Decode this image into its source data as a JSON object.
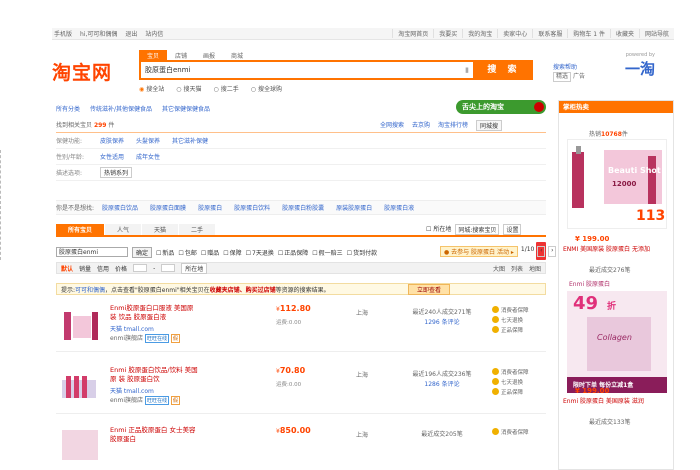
{
  "topbar": {
    "left": [
      "手机版",
      "hi,可可和偶偶",
      "退出",
      "站内信"
    ],
    "right": [
      "淘宝网首页",
      "我要买",
      "我的淘宝",
      "卖家中心",
      "联系客服",
      "购物车 1 件",
      "收藏夹",
      "网站导航"
    ]
  },
  "logo": "淘宝网",
  "search": {
    "tabs": [
      "宝贝",
      "店铺",
      "画报",
      "商城"
    ],
    "value": "胶原蛋白enmi",
    "button": "搜 索",
    "radios": [
      "搜全站",
      "搜天猫",
      "搜二手",
      "搜全球购"
    ],
    "help_line1": "搜索帮助",
    "help_ad": "精选",
    "help_line2": "广告",
    "yitao": "一淘",
    "yitao_small": "powered by"
  },
  "crumbs": [
    "所有分类",
    "传统滋补/其他保健食品",
    "其它保健保健食品"
  ],
  "banner": "舌尖上的淘宝",
  "result": {
    "found_prefix": "找到相关宝贝",
    "found_count": "299",
    "found_suffix": "件",
    "tools": [
      "全网搜索",
      "去京购",
      "淘宝排行榜"
    ],
    "tools_box": "同城搜"
  },
  "filters": [
    {
      "label": "保健功能:",
      "values": [
        "皮肤保养",
        "头髮保养",
        "其它滋补保健"
      ]
    },
    {
      "label": "性别/年龄:",
      "values": [
        "女性适用",
        "成年女性"
      ]
    },
    {
      "label": "描述选项:",
      "select": "热销系列"
    }
  ],
  "related": {
    "label": "你是不是想找:",
    "items": [
      "胶原蛋白饮品",
      "胶原蛋白面膜",
      "胶原蛋白",
      "胶原蛋白饮料",
      "胶原蛋白粉胶囊",
      "原装胶原蛋白",
      "胶原蛋白液"
    ]
  },
  "result_tabs": [
    "所有宝贝",
    "人气",
    "天猫",
    "二手"
  ],
  "mini": {
    "check": "所在地",
    "box1": "同城:搜索宝贝",
    "box2": "设置"
  },
  "filter_row": {
    "input": "胶原蛋白enmi",
    "confirm": "确定",
    "checks": [
      "新品",
      "包邮",
      "赠品",
      "保障",
      "7天退换",
      "正品保障",
      "假一赔三",
      "货到付款"
    ]
  },
  "pager": {
    "tip": "● 去参与 胶原蛋白 活动 ▸",
    "pages": "1/10"
  },
  "sortbar": {
    "items": [
      "默认",
      "销量",
      "信用",
      "价格"
    ],
    "sep": "-",
    "select": "所在地",
    "right": [
      "大图",
      "列表",
      "地图"
    ]
  },
  "notice": {
    "prefix": "提示:",
    "link": "可可和偶偶",
    "text": "，点击查看\"胶原蛋白enmi\"相关宝贝在",
    "bold": "收藏夹店铺、购买过店铺",
    "tail": "等资源的搜索结果。",
    "button": "立即查看"
  },
  "items": [
    {
      "title": "Enmi胶原蛋白口服液 美国原",
      "title_hl": "装 饮品 胶原蛋白液",
      "shop": "天猫 tmall.com",
      "shop2": "enmi旗舰店",
      "badge": "旺旺在线",
      "badge2": "假",
      "price": "112.80",
      "price_prefix": "¥",
      "pnote": "运费:0.00",
      "loc": "上海",
      "sales": "最近240人成交271笔",
      "reviews": "1296 条评论",
      "svc": [
        "消费者保障",
        "七天退换",
        "正品保障"
      ]
    },
    {
      "title": "Enmi 胶原蛋白饮品/饮料 美国原",
      "title_hl": "装 胶原蛋白饮",
      "shop": "天猫 tmall.com",
      "shop2": "enmi旗舰店",
      "badge": "旺旺在线",
      "badge2": "假",
      "price": "70.80",
      "price_prefix": "¥",
      "pnote": "运费:0.00",
      "loc": "上海",
      "sales": "最近196人成交236笔",
      "reviews": "1286 条评论",
      "svc": [
        "消费者保障",
        "七天退换",
        "正品保障"
      ]
    },
    {
      "title": "Enmi 正品胶原蛋白 女士美容",
      "title_hl": "胶原蛋白",
      "shop": "",
      "shop2": "",
      "badge": "",
      "badge2": "",
      "price": "850.00",
      "price_prefix": "¥",
      "pnote": "",
      "loc": "上海",
      "sales": "最近成交205笔",
      "reviews": "",
      "svc": [
        "消费者保障"
      ]
    }
  ],
  "side": {
    "header": "掌柜热卖",
    "count_prefix": "热销",
    "count": "10768",
    "count_suffix": "件",
    "p1_brand": "Beauti Shot",
    "p1_num": "12000",
    "p1_price": "113",
    "price1": "¥ 199.00",
    "title1": "ENMI 美国原装 胶原蛋白 无",
    "title1_hl": "添加",
    "sales1": "最近成交276笔",
    "p2_brand": "Collagen",
    "p2_num": "49",
    "p2_tag": "折",
    "p2_banner": "限时下单 每份立减1盒",
    "price2": "¥ 199.00",
    "title2": "Enmi 胶原蛋白 美国原装 滋",
    "title2_hl": "润",
    "sales2": "最近成交133笔",
    "p2_top": "Enmi 胶原蛋白"
  }
}
